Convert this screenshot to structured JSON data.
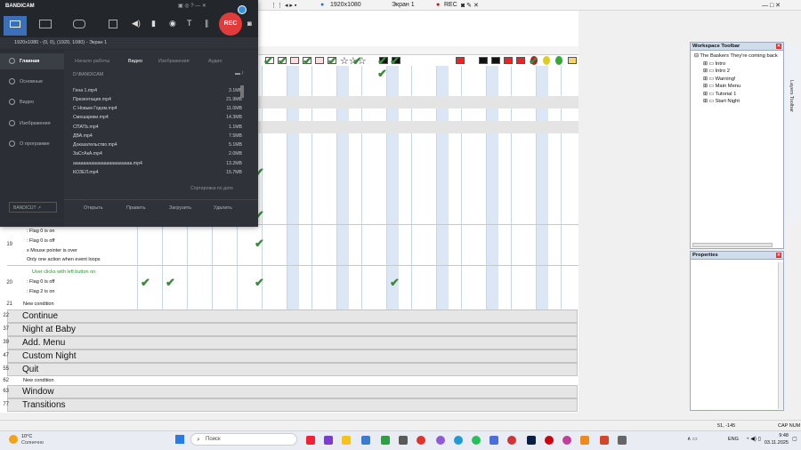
{
  "topbar": {
    "resolution": "1920x1080",
    "screen": "Экран 1",
    "rec": "REC"
  },
  "bandicam": {
    "brand": "BANDICAM",
    "rec_button": "REC",
    "source_line": "1920x1080 - (0, 0), (1920, 1080) - Экран 1",
    "sidebar": [
      {
        "label": "Главная",
        "icon": "home-icon"
      },
      {
        "label": "Основные",
        "icon": "gear-icon"
      },
      {
        "label": "Видео",
        "icon": "video-icon"
      },
      {
        "label": "Изображения",
        "icon": "image-icon"
      },
      {
        "label": "О программе",
        "icon": "info-icon"
      }
    ],
    "bandicut_label": "BANDICUT ↗",
    "tabs": [
      "Начало работы",
      "Видео",
      "Изображения",
      "Аудио"
    ],
    "path": "D:\\BANDICAM",
    "files": [
      {
        "name": "Гена 1.mp4",
        "size": "3.1MB"
      },
      {
        "name": "Презентация.mp4",
        "size": "21.9MB"
      },
      {
        "name": "С Новым Годом.mp4",
        "size": "11.0MB"
      },
      {
        "name": "Смешарики.mp4",
        "size": "14.3MB"
      },
      {
        "name": "СПАТЬ.mp4",
        "size": "1.1MB"
      },
      {
        "name": "ДВА.mp4",
        "size": "7.5MB"
      },
      {
        "name": "Доказательство.mp4",
        "size": "5.1MB"
      },
      {
        "name": "ЗаСтАкА.mp4",
        "size": "2.0MB"
      },
      {
        "name": "ааааааааааааааааааааааа.mp4",
        "size": "13.2MB"
      },
      {
        "name": "КОЗЕЛ.mp4",
        "size": "15.7MB"
      }
    ],
    "sort_label": "Сортировка по дате",
    "actions": [
      "Открыть",
      "Править",
      "Загрузить",
      "Удалить"
    ]
  },
  "events": {
    "row19": {
      "num": "19",
      "lines": [
        ": Flag 0 is on",
        ": Flag 0 is off",
        "x  Mouse pointer is over",
        "Only one action when event loops"
      ]
    },
    "row20": {
      "num": "20",
      "lines": [
        "User clicks with left button on",
        ": Flag 0 is off",
        ": Flag 2 is on"
      ]
    },
    "row21": {
      "num": "21",
      "text": "New condition"
    },
    "groups": [
      {
        "num": "22",
        "label": "Continue"
      },
      {
        "num": "37",
        "label": "Night at Baby"
      },
      {
        "num": "39",
        "label": "Add. Menu"
      },
      {
        "num": "47",
        "label": "Custom Night"
      },
      {
        "num": "55",
        "label": "Quit"
      }
    ],
    "row62": {
      "num": "62",
      "text": "New condition"
    },
    "groups2": [
      {
        "num": "63",
        "label": "Window"
      },
      {
        "num": "77",
        "label": "Transitions"
      }
    ]
  },
  "workspace": {
    "title": "Workspace Toolbar",
    "root": "The Baskers They're coming back",
    "frames": [
      "Intro",
      "Intro 2",
      "Warning!",
      "Main Menu",
      "Tutorial 1",
      "Start Night"
    ],
    "side_tab": "Layers Toolbar"
  },
  "properties": {
    "title": "Properties"
  },
  "status": {
    "coords": "51, -145",
    "mode": "CAP NUM"
  },
  "taskbar": {
    "weather_temp": "10°C",
    "weather_text": "Солнечно",
    "search": "Поиск",
    "lang": "ENG",
    "time": "9:48",
    "date": "03.11.2025"
  }
}
